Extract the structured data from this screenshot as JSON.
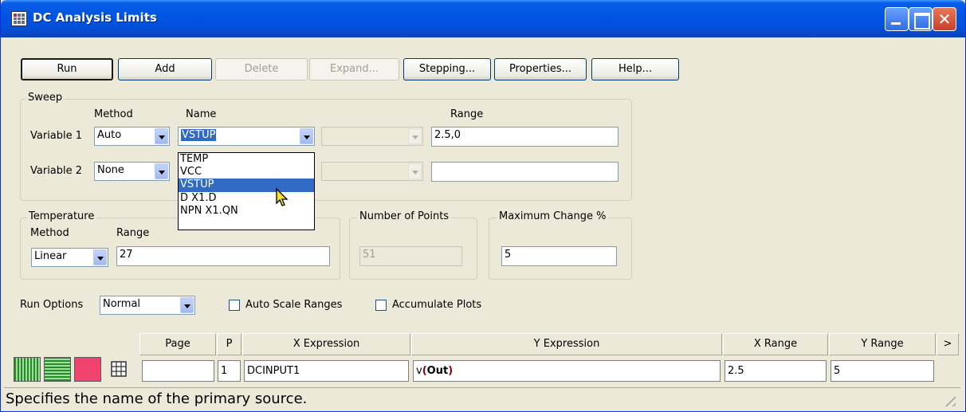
{
  "window": {
    "title": "DC Analysis Limits",
    "close_symbol": "✕"
  },
  "toolbar": {
    "run": "Run",
    "add": "Add",
    "delete": "Delete",
    "expand": "Expand...",
    "stepping": "Stepping...",
    "properties": "Properties...",
    "help": "Help..."
  },
  "sweep": {
    "legend": "Sweep",
    "method_header": "Method",
    "name_header": "Name",
    "range_header": "Range",
    "variable1": {
      "label": "Variable 1",
      "method": "Auto",
      "name": "VSTUP",
      "range": "2.5,0"
    },
    "variable2": {
      "label": "Variable 2",
      "method": "None",
      "name": "",
      "range": ""
    },
    "name_options": [
      "TEMP",
      "VCC",
      "VSTUP",
      "D X1.D",
      "NPN X1.QN"
    ],
    "highlighted_option": "VSTUP"
  },
  "temperature": {
    "legend": "Temperature",
    "method_label": "Method",
    "range_label": "Range",
    "method": "Linear",
    "range": "27"
  },
  "points": {
    "legend": "Number of Points",
    "value": "51"
  },
  "max_change": {
    "legend": "Maximum Change %",
    "value": "5"
  },
  "run_options": {
    "label": "Run Options",
    "value": "Normal",
    "auto_scale": "Auto Scale Ranges",
    "accumulate": "Accumulate Plots"
  },
  "grid": {
    "headers": {
      "page": "Page",
      "p": "P",
      "x_expression": "X Expression",
      "y_expression": "Y Expression",
      "x_range": "X Range",
      "y_range": "Y Range",
      "more": ">"
    },
    "row": {
      "page": "",
      "p": "1",
      "x_expression": "DCINPUT1",
      "y_prefix": "v",
      "y_open": "(",
      "y_arg": "Out",
      "y_close": ")",
      "x_range": "2.5",
      "y_range": "5"
    }
  },
  "status": "Specifies the name of the primary source.",
  "colors": {
    "title_bar": "#0054e3",
    "selection": "#316ac5",
    "plot_color": "#f0436e",
    "paren_color": "#8b0000"
  }
}
